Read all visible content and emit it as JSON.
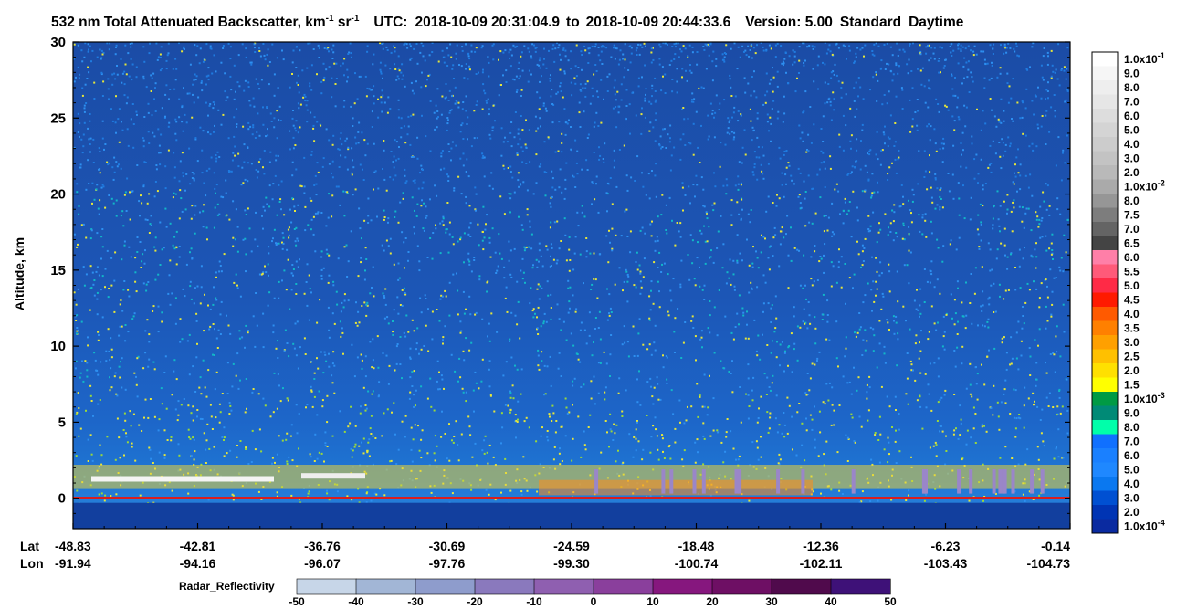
{
  "header": {
    "title_main": "532 nm Total Attenuated Backscatter, km",
    "title_exp1": "-1",
    "title_sr": " sr",
    "title_exp2": "-1",
    "utc_label": "UTC:",
    "utc_start": "2018-10-09 20:31:04.9",
    "to": "to",
    "utc_end": "2018-10-09 20:44:33.6",
    "version_label": "Version: 5.00",
    "product": "Standard",
    "daynight": "Daytime"
  },
  "chart_data": {
    "type": "heatmap",
    "ylabel": "Altitude, km",
    "ylim": [
      -2,
      30
    ],
    "yticks": [
      0,
      5,
      10,
      15,
      20,
      25,
      30
    ],
    "x_row_labels": [
      "Lat",
      "Lon"
    ],
    "x_ticks": [
      {
        "lat": "-48.83",
        "lon": "-91.94"
      },
      {
        "lat": "-42.81",
        "lon": "-94.16"
      },
      {
        "lat": "-36.76",
        "lon": "-96.07"
      },
      {
        "lat": "-30.69",
        "lon": "-97.76"
      },
      {
        "lat": "-24.59",
        "lon": "-99.30"
      },
      {
        "lat": "-18.48",
        "lon": "-100.74"
      },
      {
        "lat": "-12.36",
        "lon": "-102.11"
      },
      {
        "lat": "-6.23",
        "lon": "-103.43"
      },
      {
        "lat": "-0.14",
        "lon": "-104.73"
      }
    ],
    "colorbar": {
      "labels": [
        "1.0x10-1",
        "9.0",
        "8.0",
        "7.0",
        "6.0",
        "5.0",
        "4.0",
        "3.0",
        "2.0",
        "1.0x10-2",
        "8.0",
        "7.5",
        "7.0",
        "6.5",
        "6.0",
        "5.5",
        "5.0",
        "4.5",
        "4.0",
        "3.5",
        "3.0",
        "2.5",
        "2.0",
        "1.5",
        "1.0x10-3",
        "9.0",
        "8.0",
        "7.0",
        "6.0",
        "5.0",
        "4.0",
        "3.0",
        "2.0",
        "1.0x10-4"
      ],
      "colors": [
        "#ffffff",
        "#f6f6f6",
        "#eeeeee",
        "#e6e6e6",
        "#dddddd",
        "#d4d4d4",
        "#cccccc",
        "#c3c3c3",
        "#b9b9b9",
        "#aaaaaa",
        "#969696",
        "#7d7d7d",
        "#646464",
        "#444444",
        "#ff7fa8",
        "#ff5a79",
        "#ff2a46",
        "#ff1a00",
        "#ff5a00",
        "#ff8000",
        "#ffa000",
        "#ffc000",
        "#ffe000",
        "#ffff00",
        "#009a44",
        "#008a76",
        "#00ffaa",
        "#1070ff",
        "#1a80ff",
        "#1f88ff",
        "#0a78f0",
        "#0050d2",
        "#0034b4",
        "#0a2aa0"
      ]
    },
    "radar_colorbar": {
      "label": "Radar_Reflectivity",
      "ticks": [
        "-50",
        "-40",
        "-30",
        "-20",
        "-10",
        "0",
        "10",
        "20",
        "30",
        "40",
        "50"
      ],
      "colors": [
        "#c7d6e8",
        "#a2b6d6",
        "#8e9ccc",
        "#8a79bd",
        "#8f5fb0",
        "#8a3f9c",
        "#86177e",
        "#6e0f64",
        "#500a4c",
        "#3e1178"
      ]
    }
  }
}
